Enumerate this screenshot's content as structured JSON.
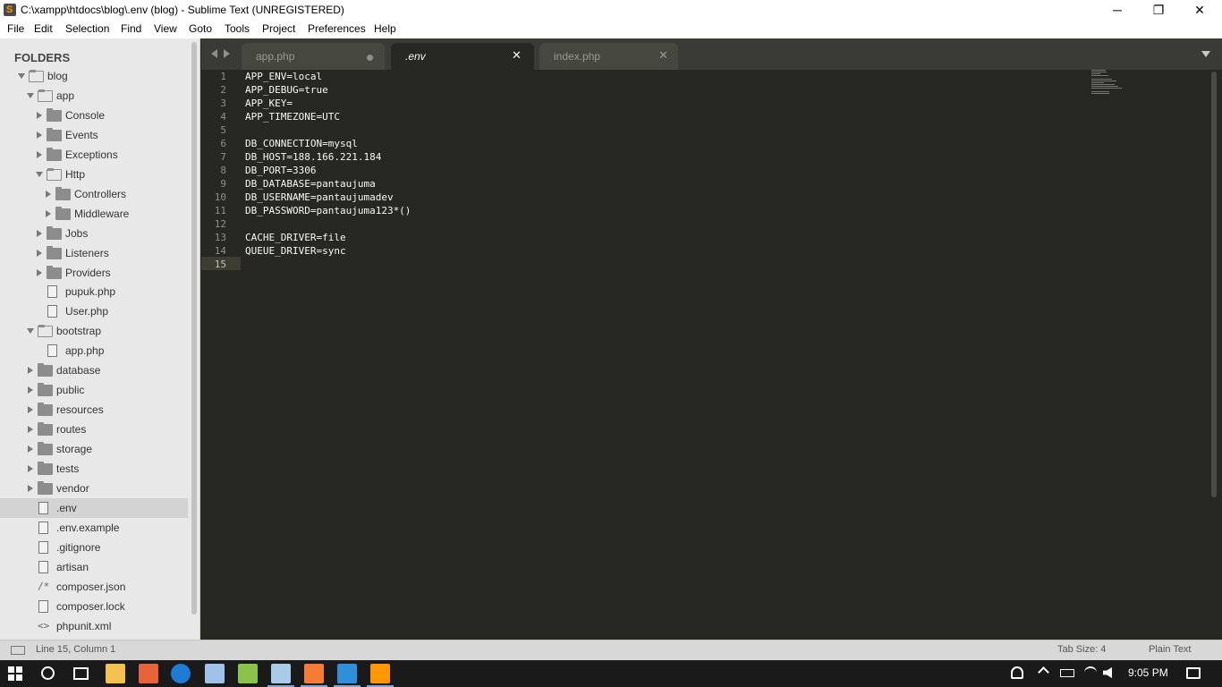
{
  "window": {
    "title": "C:\\xampp\\htdocs\\blog\\.env (blog) - Sublime Text (UNREGISTERED)",
    "minimize_glyph": "─",
    "maximize_glyph": "❐",
    "close_glyph": "✕"
  },
  "menu": [
    "File",
    "Edit",
    "Selection",
    "Find",
    "View",
    "Goto",
    "Tools",
    "Project",
    "Preferences",
    "Help"
  ],
  "sidebar": {
    "header": "FOLDERS",
    "tree": [
      {
        "label": "blog",
        "kind": "folder",
        "expanded": true,
        "depth": 0
      },
      {
        "label": "app",
        "kind": "folder",
        "expanded": true,
        "depth": 1
      },
      {
        "label": "Console",
        "kind": "folder",
        "expanded": false,
        "depth": 2
      },
      {
        "label": "Events",
        "kind": "folder",
        "expanded": false,
        "depth": 2
      },
      {
        "label": "Exceptions",
        "kind": "folder",
        "expanded": false,
        "depth": 2
      },
      {
        "label": "Http",
        "kind": "folder",
        "expanded": true,
        "depth": 2
      },
      {
        "label": "Controllers",
        "kind": "folder",
        "expanded": false,
        "depth": 3
      },
      {
        "label": "Middleware",
        "kind": "folder",
        "expanded": false,
        "depth": 3
      },
      {
        "label": "Jobs",
        "kind": "folder",
        "expanded": false,
        "depth": 2
      },
      {
        "label": "Listeners",
        "kind": "folder",
        "expanded": false,
        "depth": 2
      },
      {
        "label": "Providers",
        "kind": "folder",
        "expanded": false,
        "depth": 2
      },
      {
        "label": "pupuk.php",
        "kind": "file",
        "depth": 2
      },
      {
        "label": "User.php",
        "kind": "file",
        "depth": 2
      },
      {
        "label": "bootstrap",
        "kind": "folder",
        "expanded": true,
        "depth": 1
      },
      {
        "label": "app.php",
        "kind": "file",
        "depth": 2
      },
      {
        "label": "database",
        "kind": "folder",
        "expanded": false,
        "depth": 1
      },
      {
        "label": "public",
        "kind": "folder",
        "expanded": false,
        "depth": 1
      },
      {
        "label": "resources",
        "kind": "folder",
        "expanded": false,
        "depth": 1
      },
      {
        "label": "routes",
        "kind": "folder",
        "expanded": false,
        "depth": 1
      },
      {
        "label": "storage",
        "kind": "folder",
        "expanded": false,
        "depth": 1
      },
      {
        "label": "tests",
        "kind": "folder",
        "expanded": false,
        "depth": 1
      },
      {
        "label": "vendor",
        "kind": "folder",
        "expanded": false,
        "depth": 1
      },
      {
        "label": ".env",
        "kind": "file",
        "depth": 1,
        "selected": true
      },
      {
        "label": ".env.example",
        "kind": "file",
        "depth": 1
      },
      {
        "label": ".gitignore",
        "kind": "file",
        "depth": 1
      },
      {
        "label": "artisan",
        "kind": "file",
        "depth": 1
      },
      {
        "label": "composer.json",
        "kind": "json",
        "depth": 1,
        "glyph": "/*"
      },
      {
        "label": "composer.lock",
        "kind": "file",
        "depth": 1
      },
      {
        "label": "phpunit.xml",
        "kind": "xml",
        "depth": 1,
        "glyph": "<>"
      }
    ]
  },
  "tabs": [
    {
      "label": "app.php",
      "active": false,
      "dirty": true
    },
    {
      "label": ".env",
      "active": true,
      "dirty": false,
      "close": "✕"
    },
    {
      "label": "index.php",
      "active": false,
      "dirty": false,
      "close": "✕"
    }
  ],
  "editor": {
    "lines": [
      "APP_ENV=local",
      "APP_DEBUG=true",
      "APP_KEY=",
      "APP_TIMEZONE=UTC",
      "",
      "DB_CONNECTION=mysql",
      "DB_HOST=188.166.221.184",
      "DB_PORT=3306",
      "DB_DATABASE=pantaujuma",
      "DB_USERNAME=pantaujumadev",
      "DB_PASSWORD=pantaujuma123*()",
      "",
      "CACHE_DRIVER=file",
      "QUEUE_DRIVER=sync",
      ""
    ],
    "current_line": 15
  },
  "status": {
    "cursor": "Line 15, Column 1",
    "tab_size": "Tab Size: 4",
    "syntax": "Plain Text"
  },
  "taskbar": {
    "apps": [
      "file-explorer-icon",
      "sublime-icon",
      "edge-icon",
      "virtualbox-icon",
      "android-studio-icon",
      "notepad-icon",
      "xampp-icon",
      "onedrive-icon",
      "sublime-text-icon"
    ],
    "clock": "9:05 PM"
  },
  "colors": {
    "editor_bg": "#272822",
    "sidebar_bg": "#e8e8e8",
    "tabbar_bg": "#3a3b35",
    "accent": "#ff9800"
  }
}
